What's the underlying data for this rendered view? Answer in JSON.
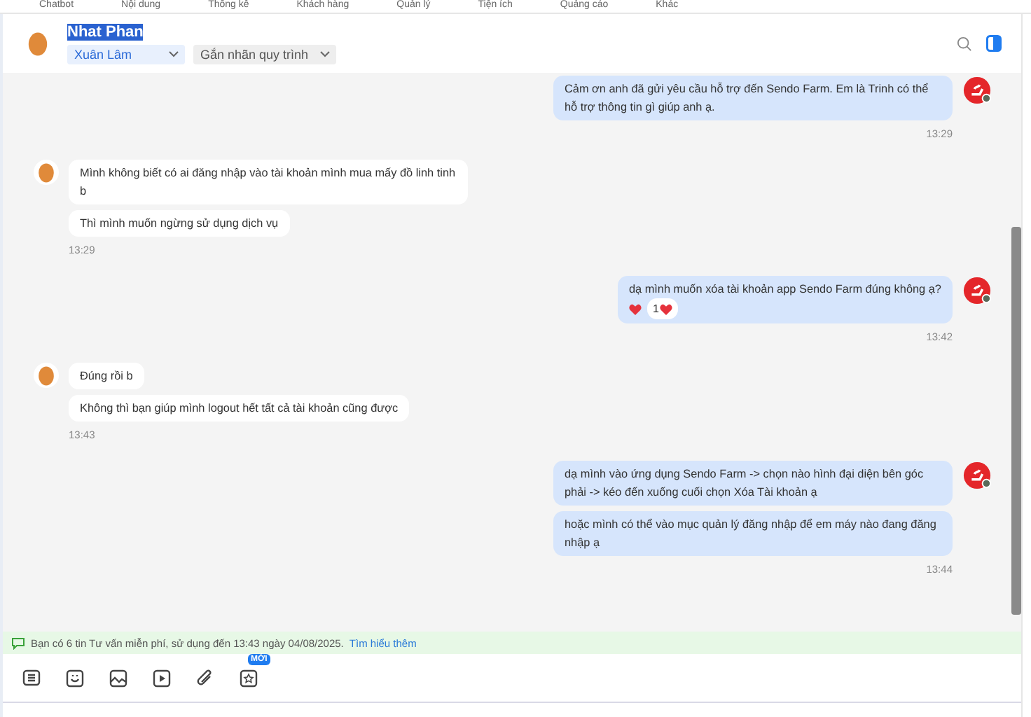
{
  "top_nav": [
    "Chatbot",
    "Nội dung",
    "Thống kê",
    "Khách hàng",
    "Quản lý",
    "Tiện ích",
    "Quảng cáo",
    "Khác"
  ],
  "header": {
    "name": "Nhat Phan",
    "name_selected": true,
    "assignee": "Xuân Lâm",
    "label_select": "Gắn nhãn quy trình"
  },
  "messages": [
    {
      "kind": "outgoing",
      "bubbles": [
        "Cảm ơn anh đã gửi yêu cầu hỗ trợ đến Sendo Farm. Em là Trinh có thể hỗ trợ thông tin gì giúp anh ạ."
      ],
      "time": "13:29"
    },
    {
      "kind": "incoming",
      "bubbles": [
        "Mình không biết có ai đăng nhập vào tài khoản mình mua mấy đồ linh tinh b",
        "Thì mình muốn ngừng sử dụng dịch vụ"
      ],
      "time": "13:29"
    },
    {
      "kind": "outgoing",
      "bubbles": [
        "dạ mình muốn xóa tài khoản app Sendo Farm đúng không ạ?"
      ],
      "reaction_count": "1",
      "time": "13:42"
    },
    {
      "kind": "incoming",
      "bubbles": [
        "Đúng rồi b",
        "Không thì bạn giúp mình logout hết tất cả tài khoản cũng được"
      ],
      "time": "13:43"
    },
    {
      "kind": "outgoing",
      "bubbles": [
        "dạ mình vào ứng dụng Sendo Farm -> chọn nào hình đại diện bên góc phải -> kéo đến xuống cuối chọn Xóa Tài khoản ạ",
        "hoặc mình có thể vào mục quản lý đăng nhập để em máy nào đang đăng nhập ạ"
      ],
      "time": "13:44"
    }
  ],
  "notice": {
    "text": "Bạn có 6 tin Tư vấn miễn phí, sử dụng đến 13:43 ngày 04/08/2025.",
    "link": "Tìm hiểu thêm"
  },
  "toolbar": {
    "new_badge": "MỚI"
  }
}
